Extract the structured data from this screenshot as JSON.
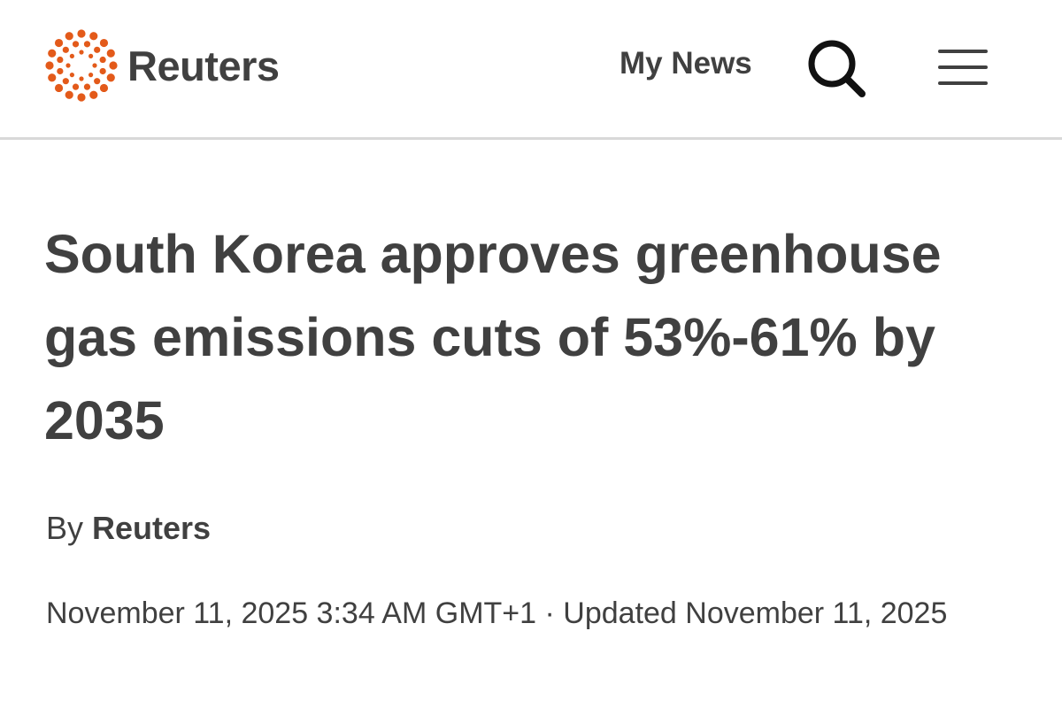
{
  "header": {
    "brand_name": "Reuters",
    "my_news_label": "My News",
    "search_icon": "search-icon",
    "menu_icon": "hamburger-menu-icon",
    "logo_icon": "reuters-dotted-ring-logo",
    "logo_color": "#e35a1a",
    "text_color": "#404040"
  },
  "article": {
    "headline": "South Korea approves greenhouse gas emissions cuts of 53%-61% by 2035",
    "byline_prefix": "By",
    "byline_author": "Reuters",
    "published": "November 11, 2025 3:34 AM GMT+1",
    "separator": "·",
    "updated": "Updated November 11, 2025"
  }
}
